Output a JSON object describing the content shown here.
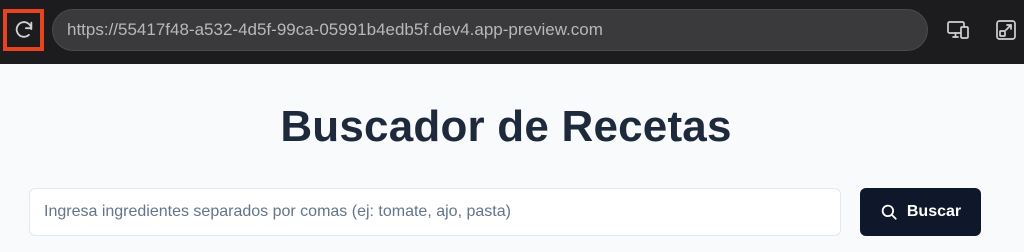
{
  "browser": {
    "url": "https://55417f48-a532-4d5f-99ca-05991b4edb5f.dev4.app-preview.com",
    "accent": "#e8431f"
  },
  "page": {
    "title": "Buscador de Recetas",
    "search": {
      "placeholder": "Ingresa ingredientes separados por comas (ej: tomate, ajo, pasta)",
      "value": "",
      "button_label": "Buscar"
    }
  },
  "icons": {
    "reload": "reload-icon",
    "devices": "devices-icon",
    "open_external": "open-external-icon",
    "search": "search-icon"
  }
}
